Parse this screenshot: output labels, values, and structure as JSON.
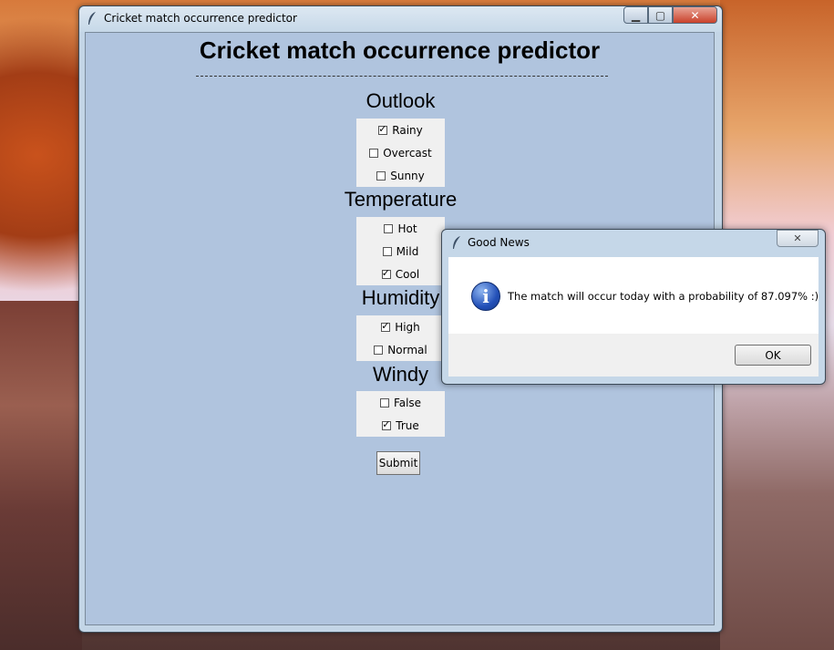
{
  "main_window": {
    "title": "Cricket match occurrence predictor",
    "controls": {
      "minimize": "▁",
      "maximize": "▢",
      "close": "✕"
    }
  },
  "app": {
    "heading": "Cricket match occurrence predictor",
    "sections": {
      "outlook": {
        "title": "Outlook",
        "options": [
          {
            "label": "Rainy",
            "checked": true
          },
          {
            "label": "Overcast",
            "checked": false
          },
          {
            "label": "Sunny",
            "checked": false
          }
        ]
      },
      "temperature": {
        "title": "Temperature",
        "options": [
          {
            "label": "Hot",
            "checked": false
          },
          {
            "label": "Mild",
            "checked": false
          },
          {
            "label": "Cool",
            "checked": true
          }
        ]
      },
      "humidity": {
        "title": "Humidity",
        "options": [
          {
            "label": "High",
            "checked": true
          },
          {
            "label": "Normal",
            "checked": false
          }
        ]
      },
      "windy": {
        "title": "Windy",
        "options": [
          {
            "label": "False",
            "checked": false
          },
          {
            "label": "True",
            "checked": true
          }
        ]
      }
    },
    "submit_label": "Submit"
  },
  "dialog": {
    "title": "Good News",
    "close": "✕",
    "icon": "info-icon",
    "message": "The match will occur today with a probability of 87.097% :)",
    "ok_label": "OK"
  }
}
